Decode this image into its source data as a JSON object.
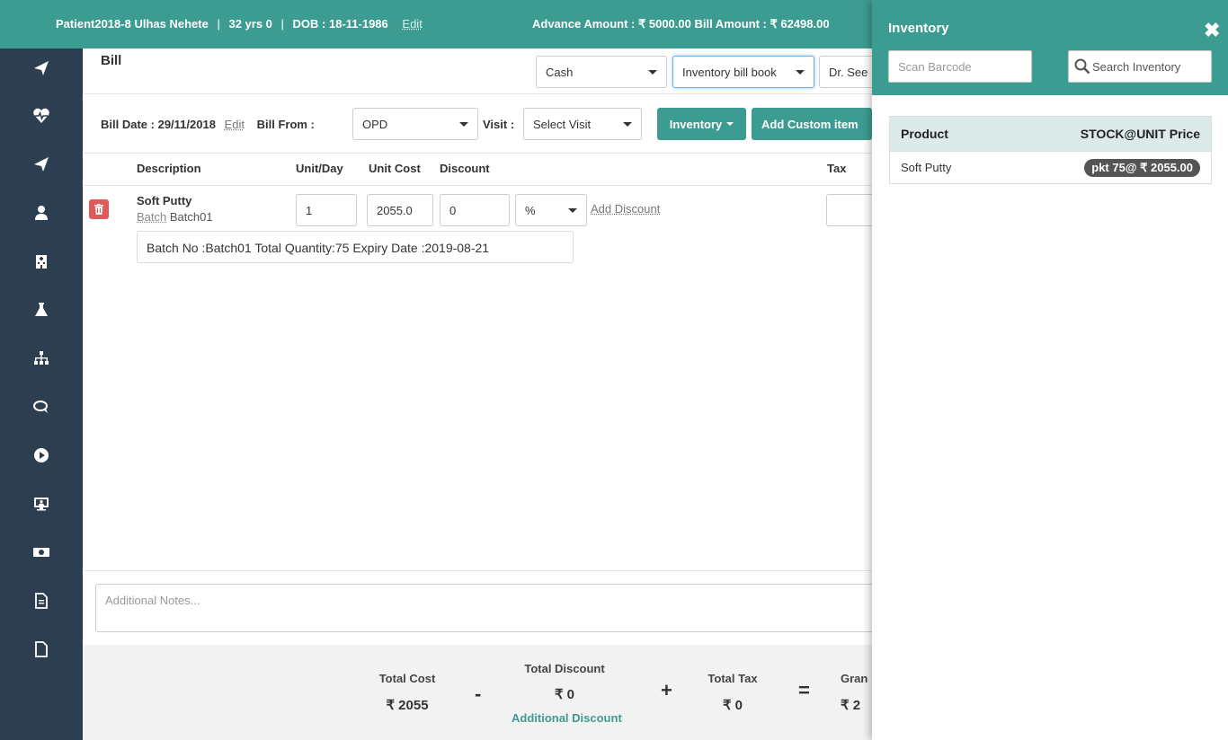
{
  "header": {
    "patient_id": "Patient2018-8",
    "patient_name": "Ulhas Nehete",
    "age": "32 yrs 0",
    "dob": "DOB : 18-11-1986",
    "edit_label": "Edit",
    "amounts": "Advance Amount : ₹ 5000.00 Bill Amount : ₹ 62498.00"
  },
  "sidebar": {
    "icons": [
      "send-icon",
      "heartbeat-icon",
      "send-icon",
      "user-icon",
      "hospital-icon",
      "flask-icon",
      "sitemap-icon",
      "chat-icon",
      "play-icon",
      "monitor-user-icon",
      "money-icon",
      "document-icon",
      "blank-file-icon"
    ]
  },
  "bill": {
    "title": "Bill",
    "payment_mode": "Cash",
    "bill_book": "Inventory bill book",
    "doctor": "Dr. See",
    "bill_date_label": "Bill Date :",
    "bill_date": "29/11/2018",
    "edit_label": "Edit",
    "bill_from_label": "Bill From :",
    "bill_from": "OPD",
    "visit_label": "Visit :",
    "visit_placeholder": "Select Visit",
    "inventory_button": "Inventory",
    "add_custom_button": "Add Custom item"
  },
  "table": {
    "headers": {
      "description": "Description",
      "unit_day": "Unit/Day",
      "unit_cost": "Unit Cost",
      "discount": "Discount",
      "tax": "Tax"
    },
    "row": {
      "name": "Soft Putty",
      "batch_label": "Batch",
      "batch": "Batch01",
      "units": "1",
      "unit_cost": "2055.0",
      "discount": "0",
      "discount_type": "%",
      "add_discount": "Add Discount",
      "batch_info": "Batch No :Batch01  Total Quantity:75  Expiry Date :2019-08-21"
    }
  },
  "notes": {
    "placeholder": "Additional Notes..."
  },
  "totals": {
    "total_cost_label": "Total Cost",
    "total_cost": "₹ 2055",
    "minus": "-",
    "total_discount_label": "Total Discount",
    "total_discount": "₹ 0",
    "additional_discount": "Additional Discount",
    "plus": "+",
    "total_tax_label": "Total Tax",
    "total_tax": "₹ 0",
    "equals": "=",
    "grand_label": "Gran",
    "grand_value": "₹ 2"
  },
  "inventory": {
    "title": "Inventory",
    "close_glyph": "✖",
    "scan_placeholder": "Scan Barcode",
    "search_button": "Search Inventory",
    "col_product": "Product",
    "col_stock": "STOCK@UNIT Price",
    "items": [
      {
        "product": "Soft Putty",
        "stock": "pkt 75@ ₹ 2055.00"
      }
    ]
  },
  "colors": {
    "teal": "#3d9c91",
    "sidebar": "#2c3e50",
    "danger": "#e05a5a"
  }
}
